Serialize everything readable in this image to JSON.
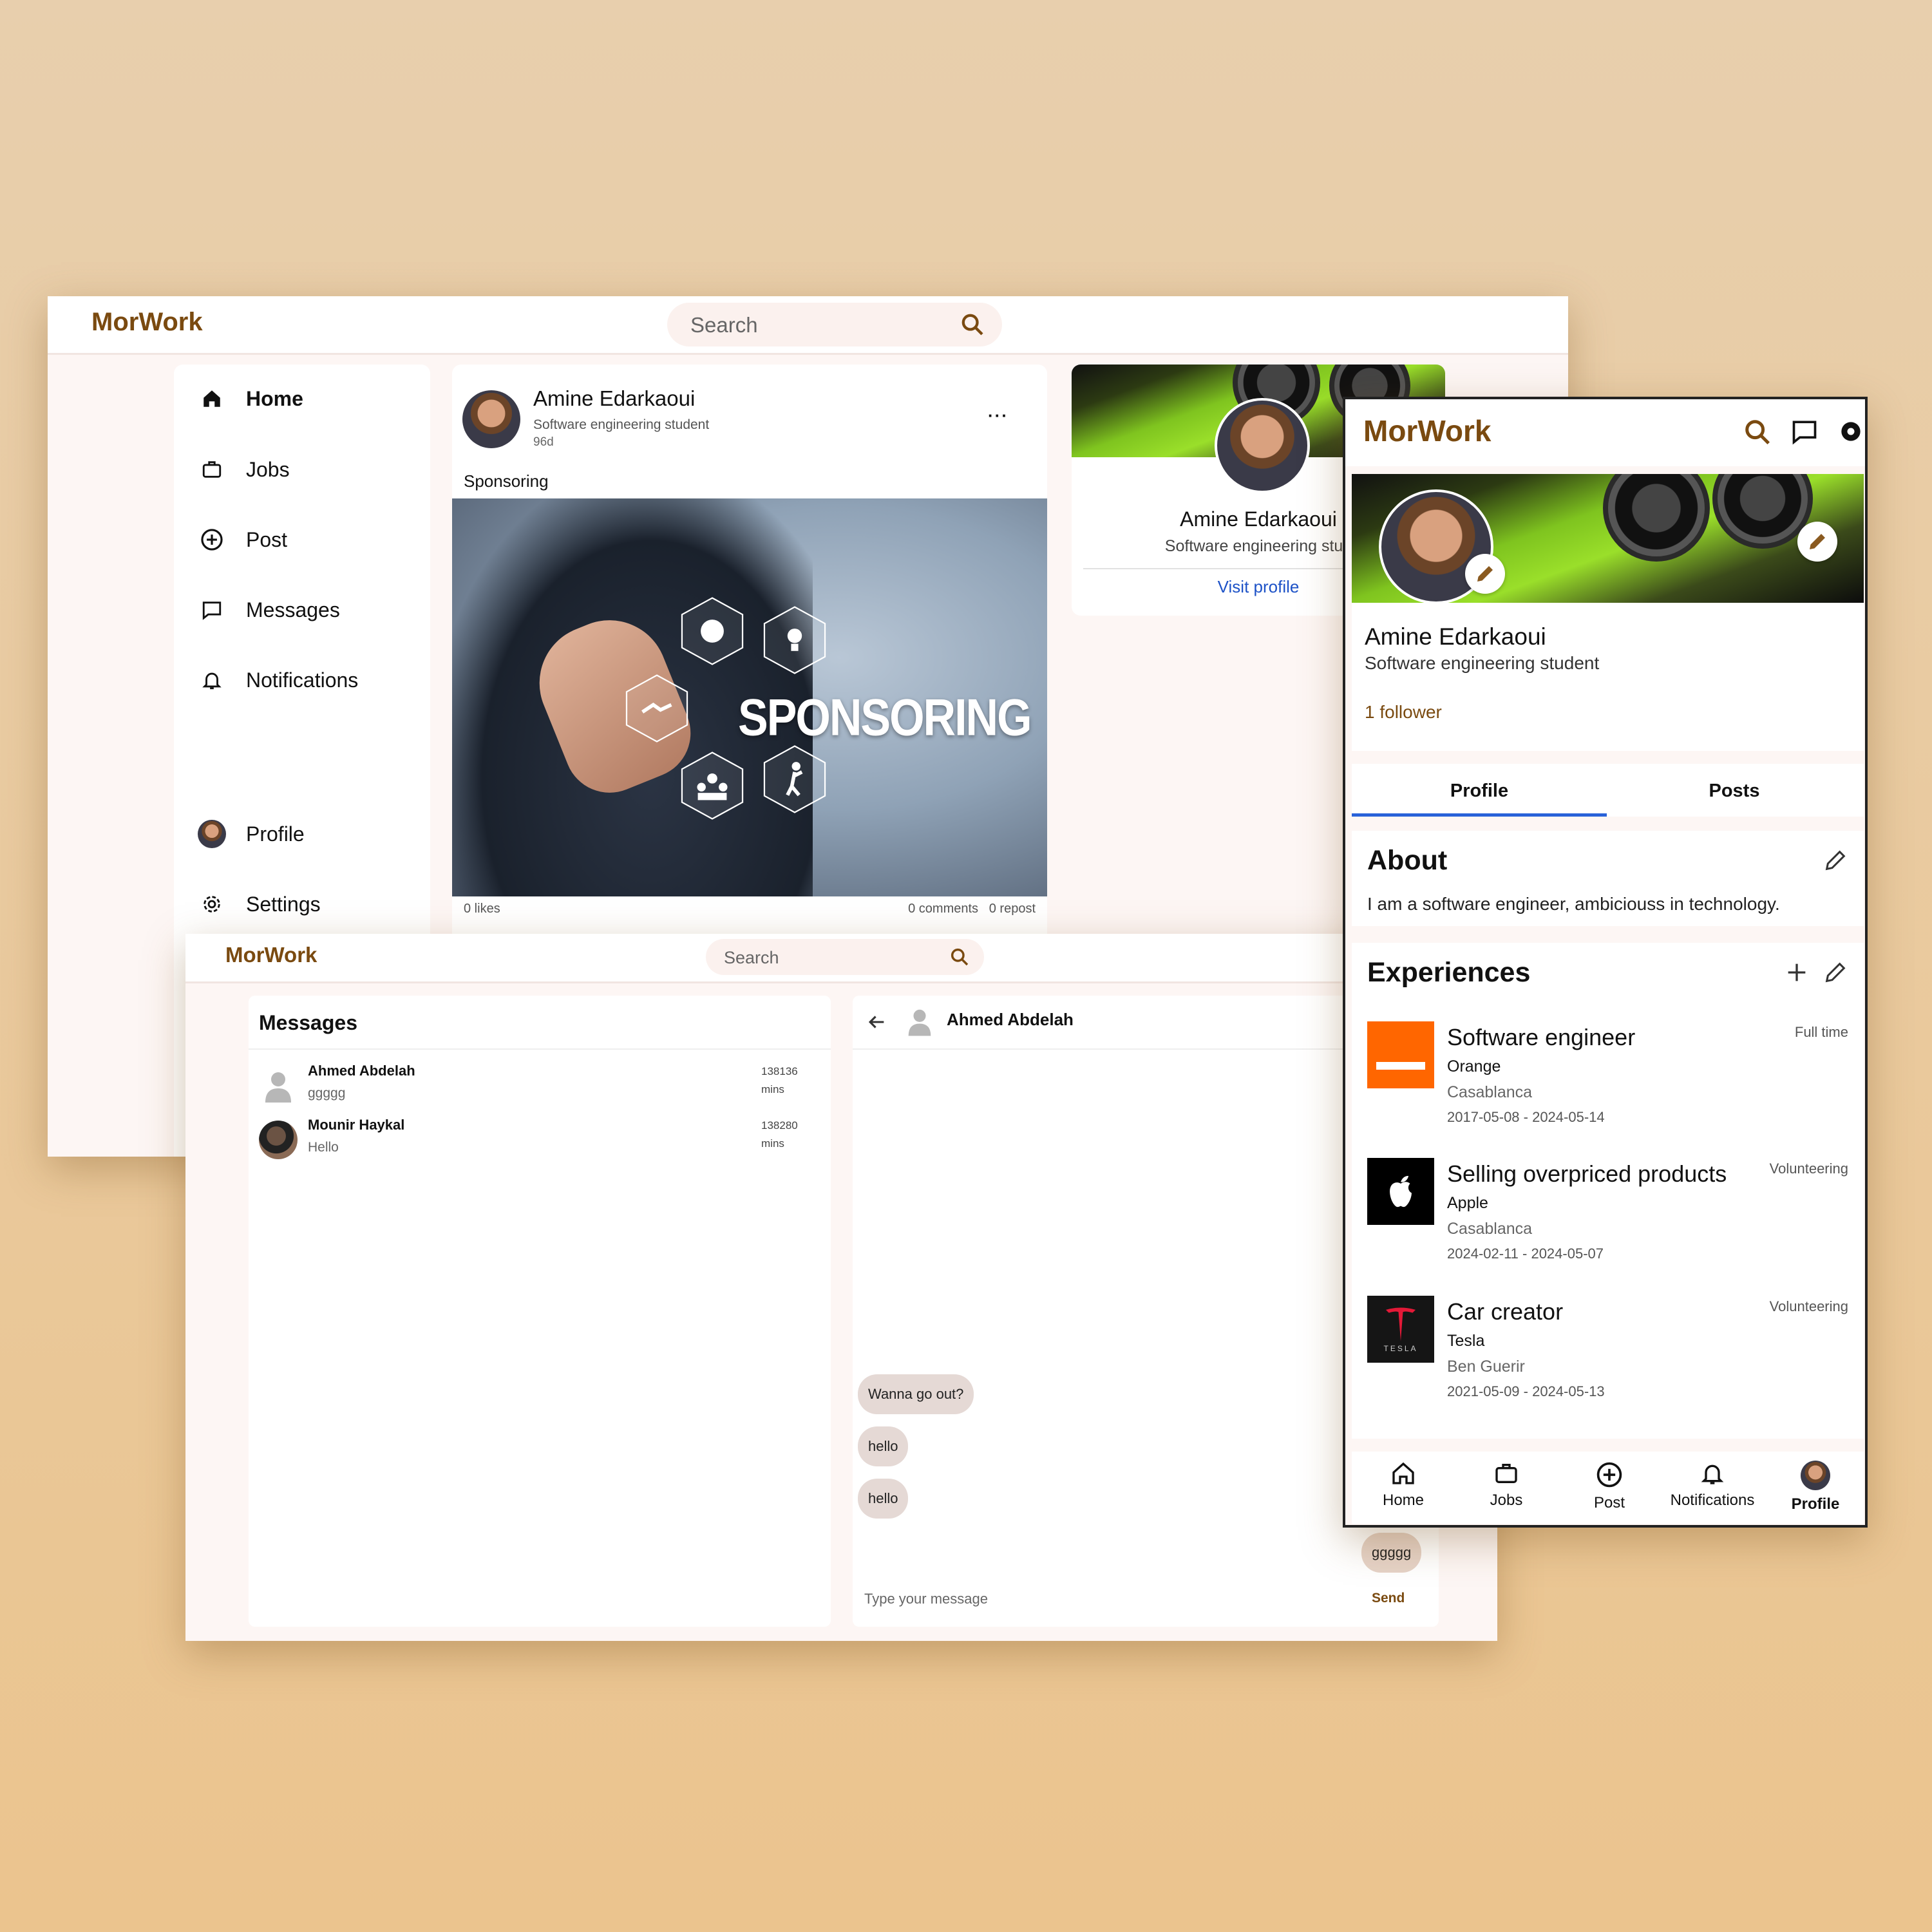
{
  "feed": {
    "brand": "MorWork",
    "search_placeholder": "Search",
    "nav": [
      {
        "label": "Home",
        "icon": "home-icon"
      },
      {
        "label": "Jobs",
        "icon": "briefcase-icon"
      },
      {
        "label": "Post",
        "icon": "plus-circle-icon"
      },
      {
        "label": "Messages",
        "icon": "chat-icon"
      },
      {
        "label": "Notifications",
        "icon": "bell-icon"
      }
    ],
    "nav_bottom": [
      {
        "label": "Profile",
        "icon": "avatar"
      },
      {
        "label": "Settings",
        "icon": "gear-icon"
      }
    ],
    "post": {
      "author": "Amine Edarkaoui",
      "subtitle": "Software engineering student",
      "age": "96d",
      "caption": "Sponsoring",
      "image_text": "SPONSORING",
      "likes": "0 likes",
      "comments": "0 comments",
      "reposts": "0 repost"
    },
    "profile_card": {
      "name": "Amine Edarkaoui",
      "subtitle": "Software engineering stud",
      "link": "Visit profile"
    }
  },
  "messages": {
    "brand": "MorWork",
    "search_placeholder": "Search",
    "title": "Messages",
    "conversations": [
      {
        "name": "Ahmed Abdelah",
        "preview": "ggggg",
        "time": "138136",
        "unit": "mins"
      },
      {
        "name": "Mounir Haykal",
        "preview": "Hello",
        "time": "138280",
        "unit": "mins"
      }
    ],
    "chat": {
      "contact": "Ahmed Abdelah",
      "bubbles": [
        "Wanna go out?",
        "hello",
        "hello",
        "ggggg"
      ],
      "input_placeholder": "Type your message",
      "send_label": "Send"
    }
  },
  "profile": {
    "brand": "MorWork",
    "name": "Amine Edarkaoui",
    "subtitle": "Software engineering student",
    "followers": "1 follower",
    "tabs": [
      "Profile",
      "Posts"
    ],
    "about_title": "About",
    "about_text": "I am a software engineer, ambiciouss in technology.",
    "experiences_title": "Experiences",
    "experiences": [
      {
        "role": "Software engineer",
        "company": "Orange",
        "location": "Casablanca",
        "dates": "2017-05-08 - 2024-05-14",
        "type": "Full time",
        "logo_color": "#ff6600"
      },
      {
        "role": "Selling overpriced products",
        "company": "Apple",
        "location": "Casablanca",
        "dates": "2024-02-11 - 2024-05-07",
        "type": "Volunteering",
        "logo_color": "#000000"
      },
      {
        "role": "Car creator",
        "company": "Tesla",
        "location": "Ben Guerir",
        "dates": "2021-05-09 - 2024-05-13",
        "type": "Volunteering",
        "logo_color": "#111111"
      }
    ],
    "tesla_logo_text": "TESLA",
    "bottom_nav": [
      "Home",
      "Jobs",
      "Post",
      "Notifications",
      "Profile"
    ]
  },
  "colors": {
    "brand": "#7a4a10",
    "link": "#1d52c7",
    "tab_underline": "#2962d9"
  }
}
